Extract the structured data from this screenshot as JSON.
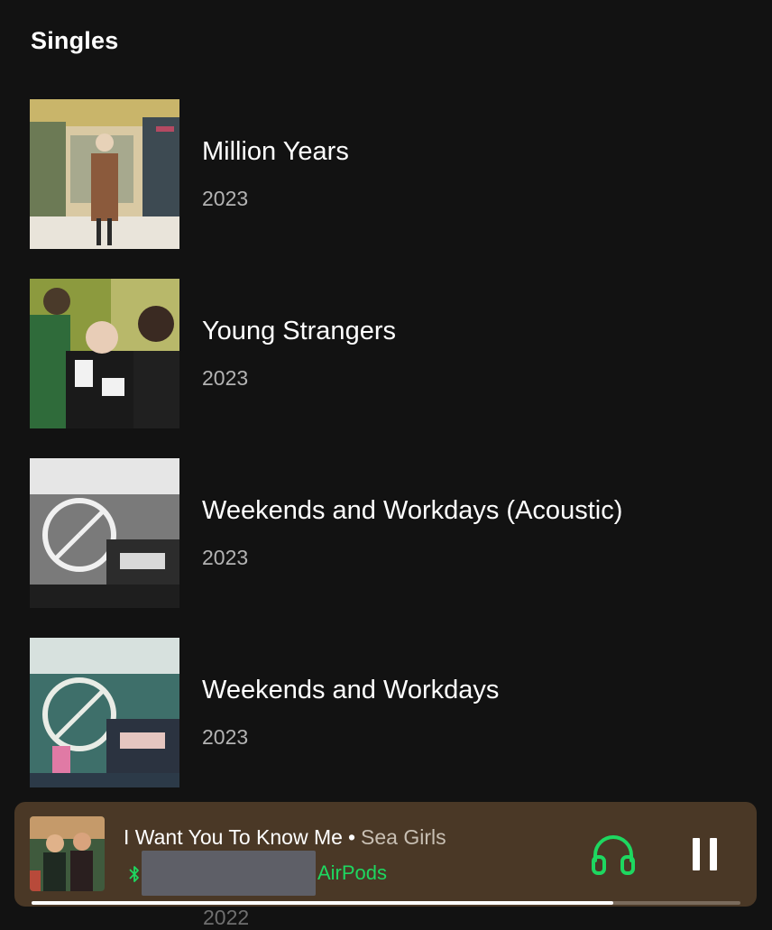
{
  "section": {
    "title": "Singles"
  },
  "singles": [
    {
      "title": "Million Years",
      "year": "2023",
      "cover_icon": "album-cover-million-years"
    },
    {
      "title": "Young Strangers",
      "year": "2023",
      "cover_icon": "album-cover-young-strangers"
    },
    {
      "title": "Weekends and Workdays (Acoustic)",
      "year": "2023",
      "cover_icon": "album-cover-weekends-acoustic"
    },
    {
      "title": "Weekends and Workdays",
      "year": "2023",
      "cover_icon": "album-cover-weekends"
    }
  ],
  "peek_item": {
    "year": "2022"
  },
  "now_playing": {
    "track": "I Want You To Know Me",
    "separator": "•",
    "artist": "Sea Girls",
    "device": "AirPods",
    "progress": 0.82,
    "icons": {
      "bluetooth": "bluetooth-icon",
      "connect": "headphones-icon",
      "pause": "pause-icon"
    }
  },
  "colors": {
    "background": "#121212",
    "now_playing_bg": "#4a3826",
    "accent_green": "#1ed760",
    "secondary_text": "#b3b3b3"
  }
}
